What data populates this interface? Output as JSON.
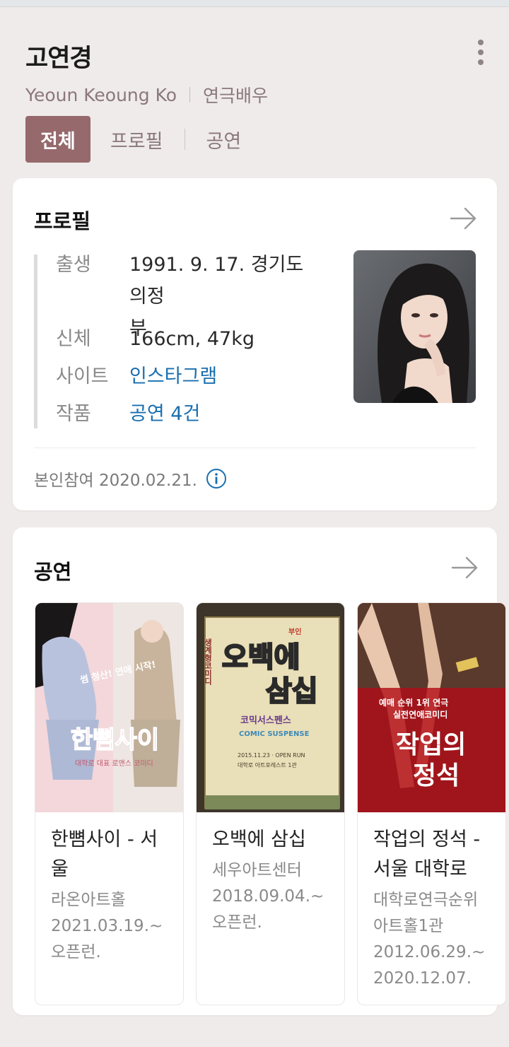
{
  "header": {
    "name": "고연경",
    "english_name": "Yeoun Keoung Ko",
    "occupation": "연극배우",
    "more_icon": "more-vertical-icon"
  },
  "tabs": [
    {
      "label": "전체",
      "active": true
    },
    {
      "label": "프로필",
      "active": false
    },
    {
      "label": "공연",
      "active": false
    }
  ],
  "profile": {
    "title": "프로필",
    "arrow_icon": "arrow-right-icon",
    "rows": [
      {
        "key": "출생",
        "value_line1": "1991. 9. 17. 경기도 의정",
        "value_line2": "부"
      },
      {
        "key": "신체",
        "value": "166cm, 47kg"
      },
      {
        "key": "사이트",
        "value": "인스타그램"
      },
      {
        "key": "작품",
        "value": "공연 4건"
      }
    ],
    "footnote": "본인참여 2020.02.21.",
    "info_icon": "info-icon",
    "link_color": "#1a6fb0"
  },
  "shows": {
    "title": "공연",
    "arrow_icon": "arrow-right-icon",
    "items": [
      {
        "title_line1": "한뼘사이 - 서",
        "title_line2": "울",
        "venue": "라온아트홀",
        "start": "2021.03.19.~",
        "end": "오픈런.",
        "poster_text": "한뼘사이",
        "poster_sub": "대학로 대표 로맨스 코미디",
        "poster_tag": "썸 청산! 연애 시작!"
      },
      {
        "title_line1": "오백에 삼십",
        "venue": "세우아트센터",
        "start": "2018.09.04.~",
        "end": "오픈런.",
        "poster_text_1": "오백에",
        "poster_text_2": "삼십",
        "poster_sub": "코믹서스펜스",
        "poster_sub2": "COMIC SUSPENSE",
        "poster_side": "생계형코미디",
        "poster_badge": "부인",
        "poster_date": "2015.11.23 · OPEN RUN",
        "poster_venue": "대학로 아트포레스트 1관"
      },
      {
        "title_line1": "작업의 정석 -",
        "title_line2": "서울 대학로",
        "venue_line1": "대학로연극순위",
        "venue_line2": "아트홀1관",
        "start": "2012.06.29.~",
        "end": "2020.12.07.",
        "poster_text_1": "작업의",
        "poster_text_2": "정석",
        "poster_tag_1": "예매 순위 1위 연극",
        "poster_tag_2": "실전연애코미디"
      }
    ]
  },
  "colors": {
    "background": "#efebea",
    "accent": "#96696c",
    "subtle_text": "#8b787b"
  }
}
